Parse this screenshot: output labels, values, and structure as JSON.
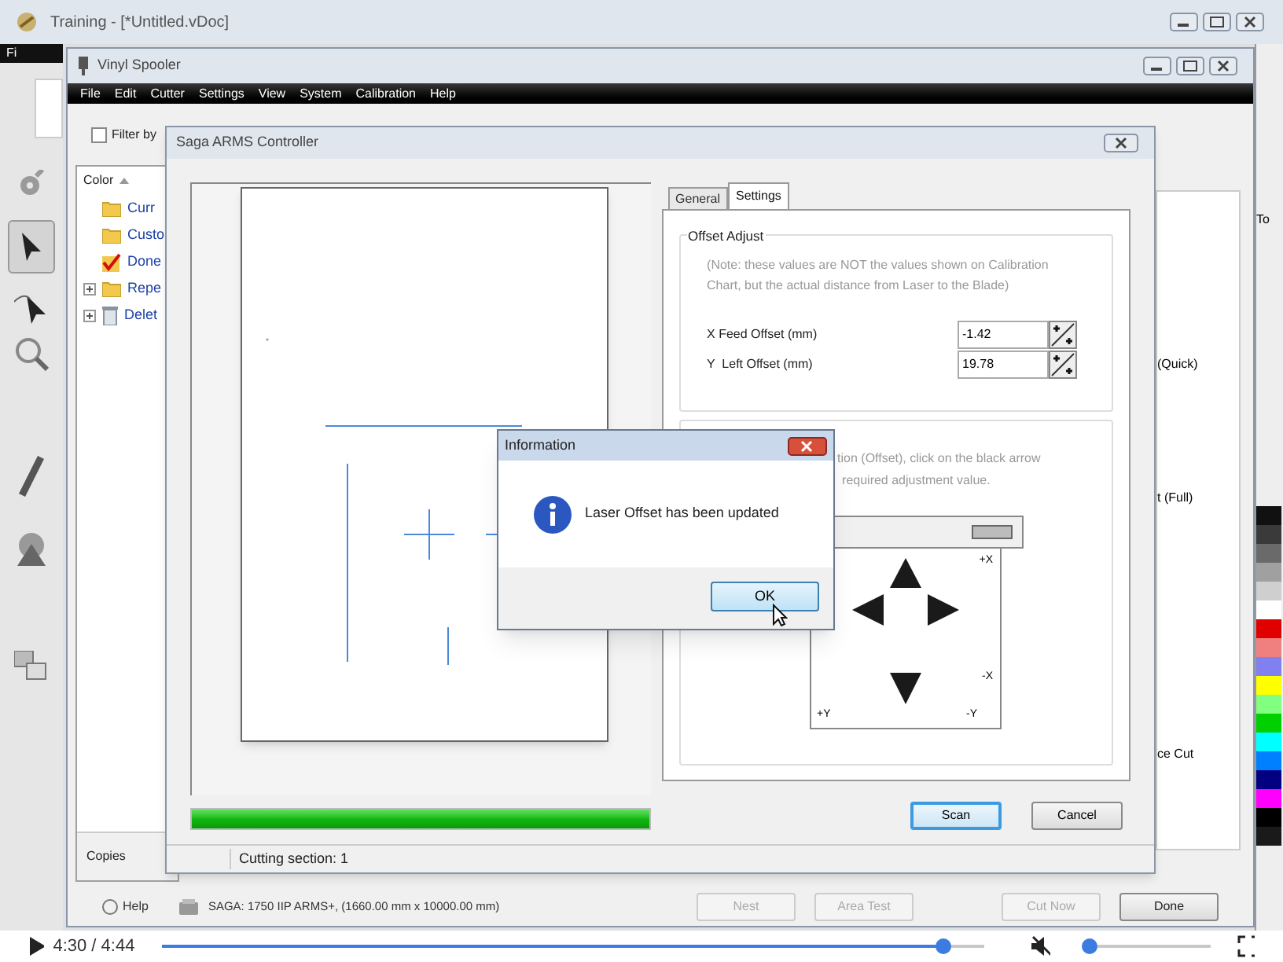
{
  "main_window": {
    "title": "Training - [*Untitled.vDoc]",
    "menu": [
      "Fi"
    ],
    "side_panel_label": "To",
    "palette": [
      {
        "color": "#111111"
      },
      {
        "color": "#3a3a3a"
      },
      {
        "color": "#6a6a6a"
      },
      {
        "color": "#a0a0a0"
      },
      {
        "color": "#cfcfcf"
      },
      {
        "color": "#ffffff"
      },
      {
        "color": "#e00000"
      },
      {
        "color": "#f08080"
      },
      {
        "color": "#8080f0"
      },
      {
        "color": "#ffff00"
      },
      {
        "color": "#80ff80"
      },
      {
        "color": "#00d000"
      },
      {
        "color": "#00ffff"
      },
      {
        "color": "#0080ff"
      },
      {
        "color": "#000080"
      },
      {
        "color": "#ff00ff"
      },
      {
        "color": "#000000"
      },
      {
        "color": "#1a1a1a"
      }
    ]
  },
  "spooler": {
    "title": "Vinyl Spooler",
    "menu": [
      "File",
      "Edit",
      "Cutter",
      "Settings",
      "View",
      "System",
      "Calibration",
      "Help"
    ],
    "filter": {
      "label": "Filter by",
      "checked": false
    },
    "list": {
      "column": "Color",
      "items": [
        {
          "label": "Curr",
          "kind": "folder",
          "expandable": false
        },
        {
          "label": "Custo",
          "kind": "folder",
          "expandable": false
        },
        {
          "label": "Done",
          "kind": "done",
          "expandable": false
        },
        {
          "label": "Repe",
          "kind": "folder",
          "expandable": true
        },
        {
          "label": "Delet",
          "kind": "trash",
          "expandable": true
        }
      ]
    },
    "copies_label": "Copies",
    "help": "Help",
    "device": "SAGA: 1750 IIP ARMS+, (1660.00 mm x 10000.00 mm)",
    "canvas_labels": [
      "(Quick)",
      "t (Full)",
      "ce Cut"
    ],
    "buttons": [
      {
        "label": "Nest",
        "disabled": true
      },
      {
        "label": "Area Test",
        "disabled": true
      },
      {
        "label": "Cut Now",
        "disabled": true
      },
      {
        "label": "Done",
        "disabled": false
      }
    ]
  },
  "controller": {
    "title": "Saga ARMS Controller",
    "progress": {
      "level": 1
    },
    "status": "Cutting section: 1",
    "tabs": [
      {
        "label": "General",
        "selected": false
      },
      {
        "label": "Settings",
        "selected": true
      }
    ],
    "offset_group": {
      "title": "Offset Adjust",
      "note": "(Note: these values are NOT the values shown on Calibration Chart, but the actual distance from Laser to the Blade)",
      "fields": [
        {
          "label": "X Feed Offset (mm)",
          "value": "-1.42"
        },
        {
          "label": "Y  Left Offset (mm)",
          "value": "19.78"
        }
      ]
    },
    "position_group": {
      "instructions": [
        "tion (Offset), click on the black arrow",
        "required adjustment value."
      ],
      "axis_labels": {
        "plus_x": "+X",
        "minus_x": "-X",
        "plus_y": "+Y",
        "minus_y": "-Y"
      }
    },
    "buttons": [
      {
        "label": "Scan",
        "default": true
      },
      {
        "label": "Cancel",
        "default": false
      }
    ]
  },
  "dialog": {
    "title": "Information",
    "message": "Laser Offset has been updated",
    "button": "OK"
  },
  "player": {
    "time": "4:30 / 4:44",
    "progress": {
      "level": 0.95
    },
    "volume": {
      "level": 0
    }
  }
}
